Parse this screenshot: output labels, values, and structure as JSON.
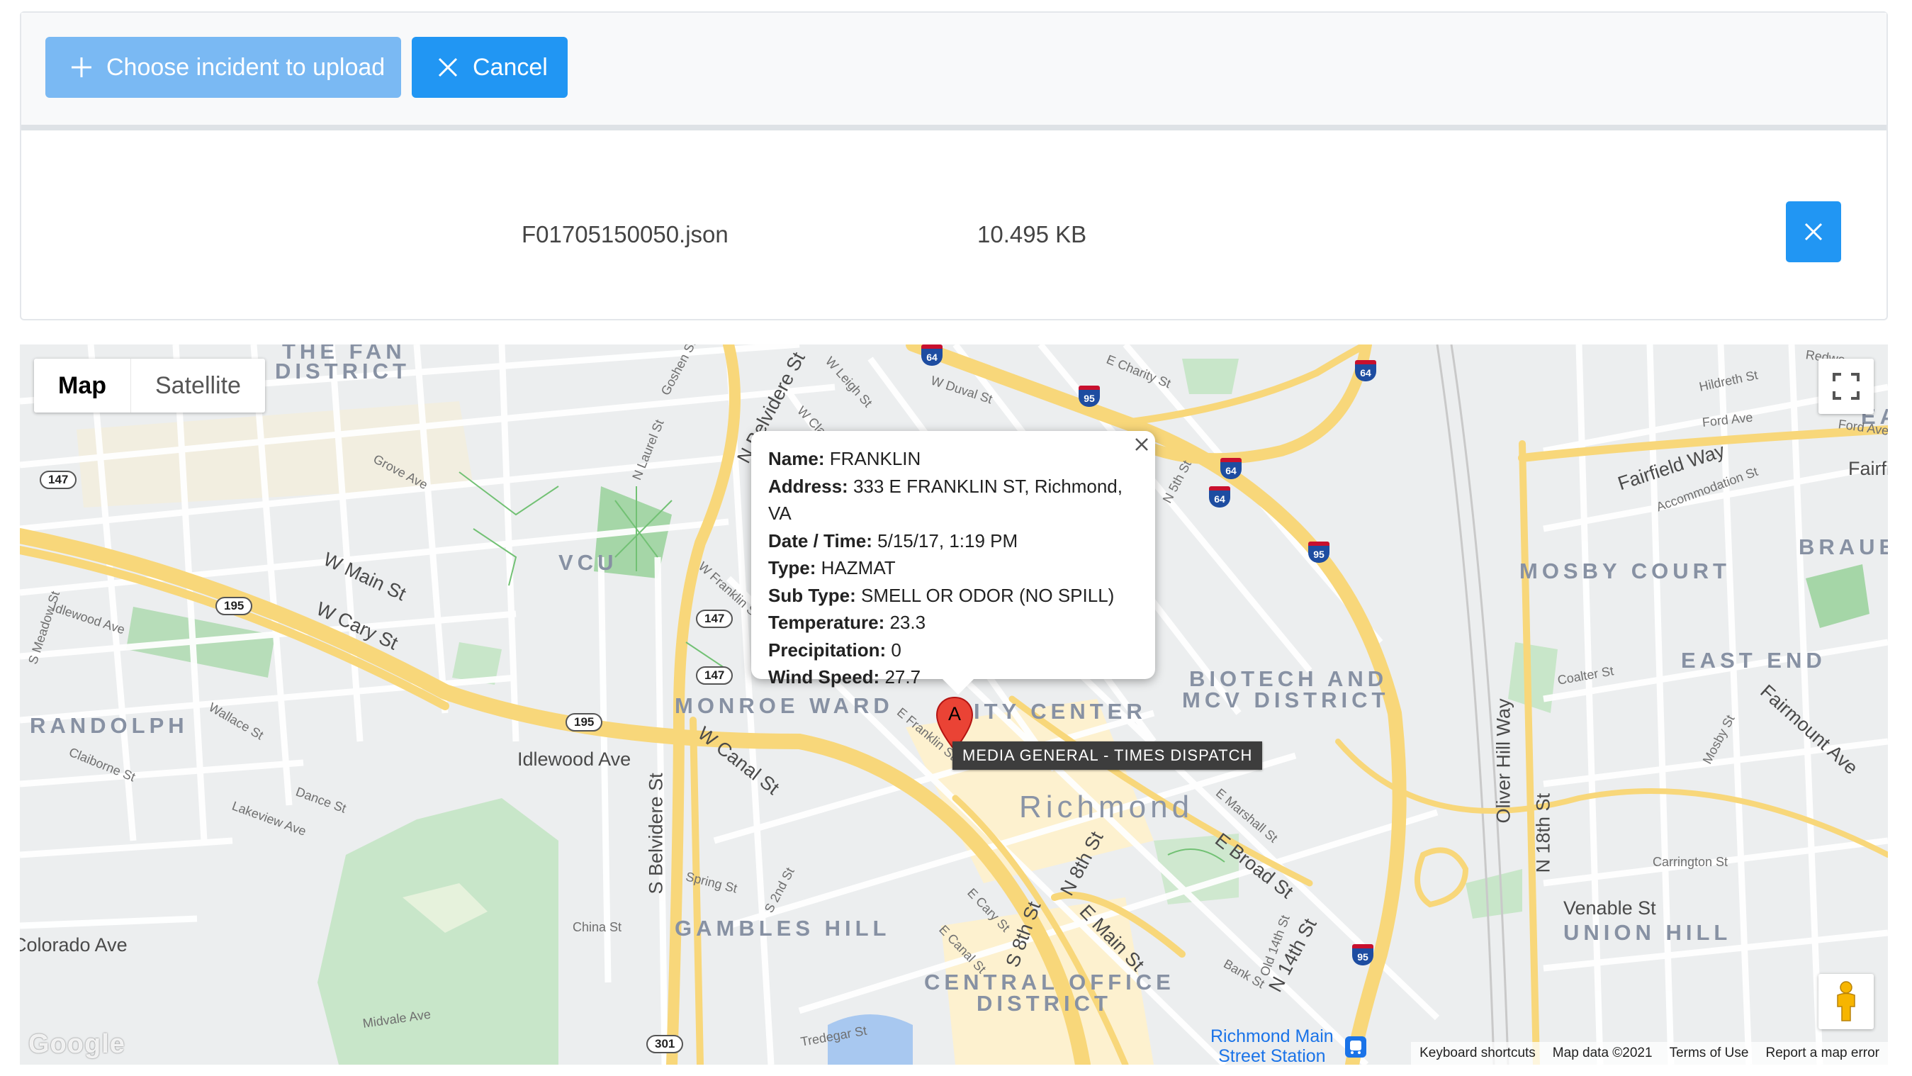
{
  "toolbar": {
    "choose_label": "Choose incident to upload",
    "cancel_label": "Cancel"
  },
  "file": {
    "name": "F01705150050.json",
    "size": "10.495 KB"
  },
  "map": {
    "type_controls": {
      "map": "Map",
      "satellite": "Satellite"
    },
    "info": {
      "name_label": "Name:",
      "name": "FRANKLIN",
      "address_label": "Address:",
      "address": "333 E FRANKLIN ST, Richmond, VA",
      "datetime_label": "Date / Time:",
      "datetime": "5/15/17, 1:19 PM",
      "type_label": "Type:",
      "type": "HAZMAT",
      "subtype_label": "Sub Type:",
      "subtype": "SMELL OR ODOR (NO SPILL)",
      "temperature_label": "Temperature:",
      "temperature": "23.3",
      "precipitation_label": "Precipitation:",
      "precipitation": "0",
      "wind_label": "Wind Speed:",
      "wind": "27.7"
    },
    "marker_label": "A",
    "tooltip": "MEDIA GENERAL - TIMES DISPATCH",
    "areas": {
      "fan": "THE FAN",
      "fan_district": "DISTRICT",
      "vcu": "VCU",
      "monroe_ward": "MONROE WARD",
      "city_center": "ITY CENTER",
      "biotech": "BIOTECH AND",
      "mcv": "MCV DISTRICT",
      "randolph": "RANDOLPH",
      "richmond": "Richmond",
      "gambles_hill": "GAMBLES HILL",
      "central_office": "CENTRAL OFFICE",
      "central_office_district": "DISTRICT",
      "mosby_court": "MOSBY COURT",
      "braue": "BRAUE",
      "east_end": "EAST END",
      "union_hill": "UNION HILL",
      "east_edge": "EA"
    },
    "streets": {
      "n_belvidere": "N Belvidere St",
      "w_leigh": "W Leigh St",
      "w_main": "W Main St",
      "w_cary": "W Cary St",
      "idlewood": "Idlewood Ave",
      "s_belvidere": "S Belvidere St",
      "w_canal": "W Canal St",
      "e_broad": "E Broad St",
      "n_8th": "N 8th St",
      "s_8th": "S 8th St",
      "e_main": "E Main St",
      "e_cary": "E Cary St",
      "e_canal": "E Canal St",
      "n_14th": "N 14th St",
      "n_18th": "N 18th St",
      "oliver_hill": "Oliver Hill Way",
      "fairfield": "Fairfield Way",
      "colorado": "Colorado Ave",
      "venable": "Venable St",
      "e_franklin": "E Franklin St",
      "w_franklin": "W Franklin St",
      "grove": "Grove Ave",
      "e_marshall": "E Marshall St",
      "carrington": "Carrington St",
      "fairmount": "Fairmount Ave",
      "mosby_st": "Mosby St",
      "china": "China St",
      "spring": "Spring St",
      "midvale": "Midvale Ave",
      "w_duval": "W Duval St",
      "e_charity": "E Charity St",
      "coalter": "Coalter St",
      "ford": "Ford Ave",
      "hildreth": "Hildreth St",
      "accommodation": "Accommodation St",
      "n_laurel": "N Laurel St",
      "wallace": "Wallace St",
      "lakeview": "Lakeview Ave",
      "dance": "Dance St",
      "claiborne": "Claiborne St",
      "tredegar": "Tredegar St",
      "bank": "Bank St",
      "s_meadow": "S Meadow St",
      "w_clay": "W Clay St",
      "n_5th": "N 5th St",
      "s_2nd": "S 2nd St",
      "goshen": "Goshen St",
      "idlewood_w": "Idlewood Ave",
      "fairfie": "Fairfie",
      "old_14th": "Old 14th St",
      "ford_ave_e": "Ford Ave",
      "redwo": "Redwo"
    },
    "shields": {
      "r147a": "147",
      "r195a": "195",
      "r147b": "147",
      "r147c": "147",
      "r195b": "195",
      "r301": "301",
      "i95a": "95",
      "i64a": "64",
      "i64b": "64",
      "i95b": "95",
      "i95c": "95",
      "i64c": "64",
      "i64d": "64"
    },
    "station": "Richmond Main Street Station",
    "station_line1": "Richmond Main",
    "station_line2": "Street Station",
    "logo": "Google",
    "attribution": {
      "shortcuts": "Keyboard shortcuts",
      "data": "Map data ©2021",
      "terms": "Terms of Use",
      "report": "Report a map error"
    }
  }
}
